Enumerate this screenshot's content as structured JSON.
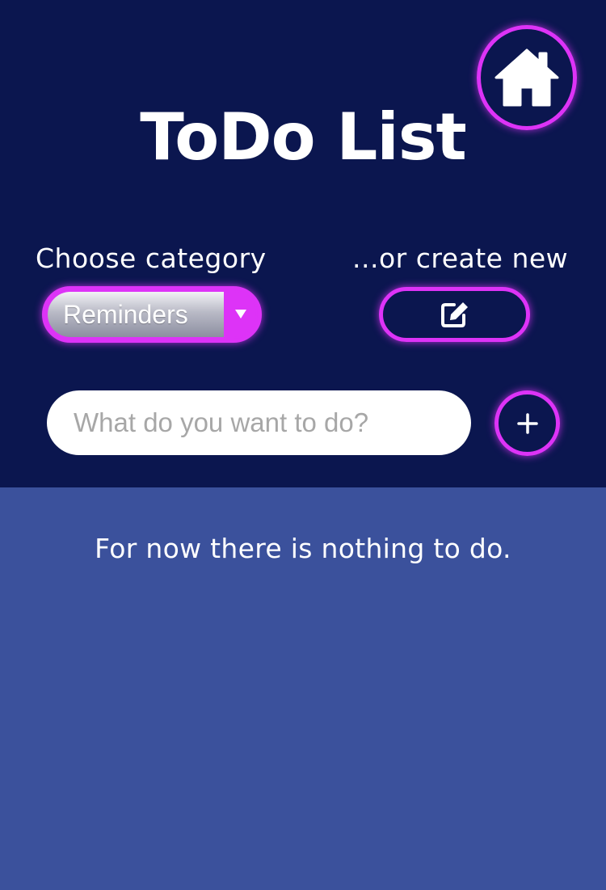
{
  "header": {
    "title": "ToDo List",
    "home_icon": "home-icon"
  },
  "category": {
    "choose_label": "Choose category",
    "selected": "Reminders",
    "create_label": "...or create new",
    "create_icon": "edit-icon"
  },
  "task_input": {
    "placeholder": "What do you want to do?",
    "value": "",
    "add_icon": "plus-icon"
  },
  "list": {
    "empty_message": "For now there is nothing to do."
  },
  "colors": {
    "header_bg": "#0b164f",
    "list_bg": "#3b519c",
    "accent": "#dd33f7",
    "text": "#ffffff"
  }
}
